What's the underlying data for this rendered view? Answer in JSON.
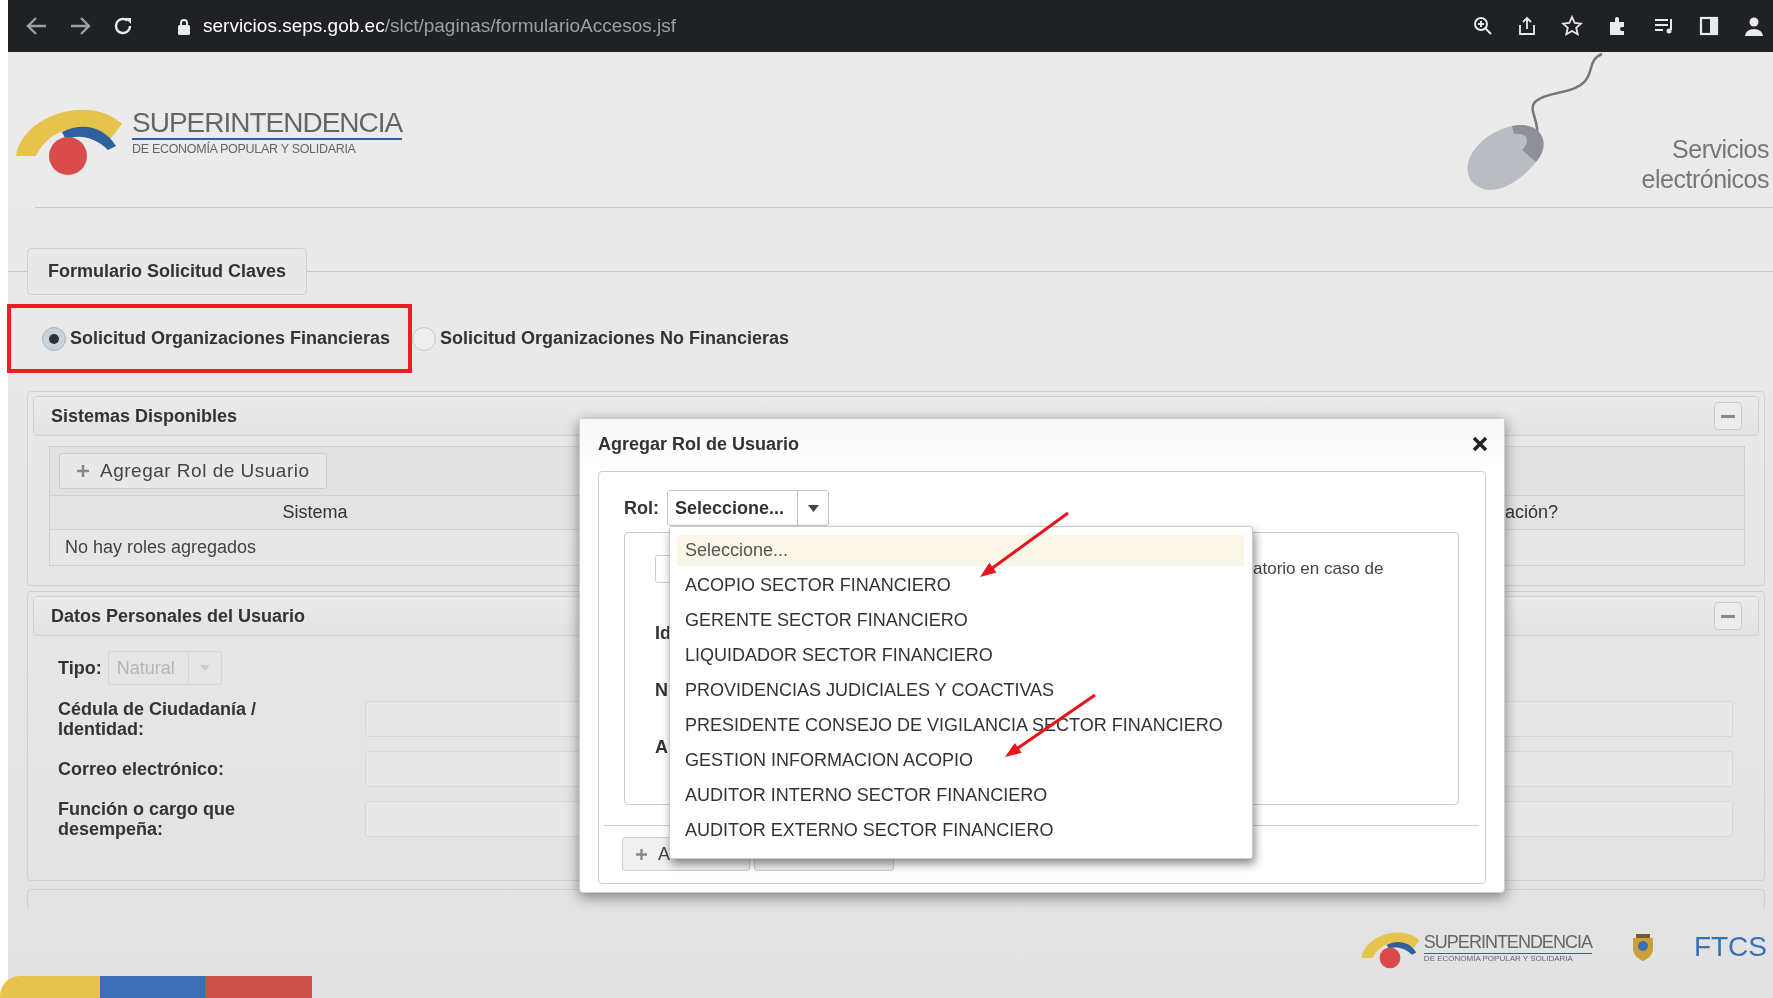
{
  "browser": {
    "url_domain": "servicios.seps.gob.ec",
    "url_path": "/slct/paginas/formularioAccesos.jsf"
  },
  "header": {
    "logo_title": "SUPERINTENDENCIA",
    "logo_subtitle": "DE ECONOMÍA POPULAR Y SOLIDARIA",
    "tagline": [
      "Servicios",
      "electrónicos"
    ]
  },
  "form_tab": "Formulario Solicitud Claves",
  "request_types": [
    {
      "label": "Solicitud Organizaciones Financieras",
      "selected": true,
      "highlighted": true
    },
    {
      "label": "Solicitud Organizaciones No Financieras",
      "selected": false,
      "highlighted": false
    }
  ],
  "systems_panel": {
    "title": "Sistemas Disponibles",
    "add_button": "Agregar Rol de Usuario",
    "columns": [
      "Sistema",
      "ación?"
    ],
    "empty_message": "No hay roles agregados"
  },
  "personal_panel": {
    "title": "Datos Personales del Usuario",
    "fields": [
      {
        "kind": "select",
        "label": "Tipo:",
        "value": "Natural",
        "disabled": true
      },
      {
        "kind": "text",
        "label": "Cédula de Ciudadanía / Identidad:"
      },
      {
        "kind": "text",
        "label": "Correo electrónico:"
      },
      {
        "kind": "text",
        "label": "Función o cargo que desempeña:"
      }
    ]
  },
  "dialog": {
    "title": "Agregar Rol de Usuario",
    "rol_label": "Rol:",
    "rol_value": "Seleccione...",
    "options": [
      {
        "label": "Seleccione...",
        "selected": true
      },
      {
        "label": "ACOPIO SECTOR FINANCIERO",
        "selected": false
      },
      {
        "label": "GERENTE SECTOR FINANCIERO",
        "selected": false
      },
      {
        "label": "LIQUIDADOR SECTOR FINANCIERO",
        "selected": false
      },
      {
        "label": "PROVIDENCIAS JUDICIALES Y COACTIVAS",
        "selected": false
      },
      {
        "label": "PRESIDENTE CONSEJO DE VIGILANCIA SECTOR FINANCIERO",
        "selected": false
      },
      {
        "label": "GESTION INFORMACION ACOPIO",
        "selected": false
      },
      {
        "label": "AUDITOR INTERNO SECTOR FINANCIERO",
        "selected": false
      },
      {
        "label": "AUDITOR EXTERNO SECTOR FINANCIERO",
        "selected": false
      }
    ],
    "note": "atorio en caso de",
    "field_labels": [
      "Id",
      "N",
      "A"
    ],
    "footer_button": "A"
  },
  "footer": {
    "logo_title": "SUPERINTENDENCIA",
    "logo_subtitle": "DE ECONOMÍA POPULAR Y SOLIDARIA",
    "brand": "FTCS"
  }
}
